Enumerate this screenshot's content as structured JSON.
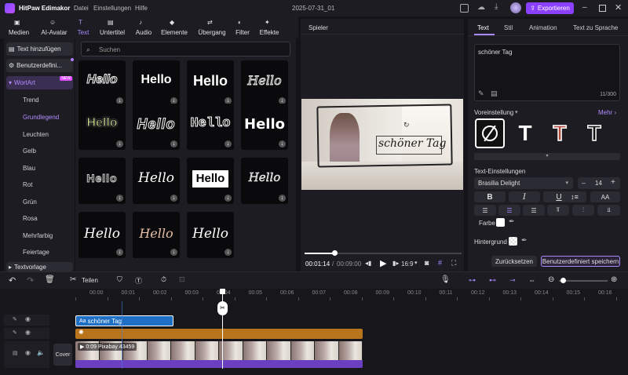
{
  "app": {
    "title": "HitPaw Edimakor",
    "project": "2025-07-31_01",
    "export": "Exportieren"
  },
  "menu": [
    "Datei",
    "Einstellungen",
    "Hilfe"
  ],
  "toolbar": [
    {
      "label": "Medien",
      "icon": "media-icon"
    },
    {
      "label": "AI-Avatar",
      "icon": "avatar-icon"
    },
    {
      "label": "Text",
      "icon": "text-icon"
    },
    {
      "label": "Untertitel",
      "icon": "subtitle-icon"
    },
    {
      "label": "Audio",
      "icon": "audio-icon"
    },
    {
      "label": "Elemente",
      "icon": "elements-icon"
    },
    {
      "label": "Übergang",
      "icon": "transition-icon"
    },
    {
      "label": "Filter",
      "icon": "filter-icon"
    },
    {
      "label": "Effekte",
      "icon": "effects-icon"
    }
  ],
  "sidebar": {
    "add_text": "Text hinzufügen",
    "custom": "Benutzerdefini...",
    "wordart": "WortArt",
    "wordart_badge": "NEW",
    "categories": [
      "Trend",
      "Grundlegend",
      "Leuchten",
      "Gelb",
      "Blau",
      "Rot",
      "Grün",
      "Rosa",
      "Mehrfarbig",
      "Feiertage"
    ],
    "textvorlage": "Textvorlage"
  },
  "search": {
    "placeholder": "Suchen"
  },
  "thumbs": {
    "hello": "Hello",
    "hello_lower": "Hello",
    "hello_script": "Hello"
  },
  "player": {
    "title": "Spieler",
    "overlay_text": "schöner Tag",
    "time_current": "00:01:14",
    "time_sep": "/",
    "time_total": "00:09:00",
    "ratio": "16:9",
    "progress": 0.19
  },
  "right": {
    "tabs": [
      "Text",
      "Stil",
      "Animation",
      "Text zu Sprache"
    ],
    "text_value": "schöner Tag",
    "char_count": "11/300",
    "preset_label": "Voreinstellung",
    "more": "Mehr",
    "text_settings": "Text-Einstellungen",
    "font": "Brasilia Delight",
    "font_size": "14",
    "bold": "B",
    "italic": "I",
    "underline": "U",
    "case": "AA",
    "color_label": "Farbe",
    "background_label": "Hintergrund",
    "reset": "Zurücksetzen",
    "save_custom": "Benutzerdefiniert speichern"
  },
  "timeline_tools": {
    "split": "Teilen"
  },
  "ruler": [
    "00:00",
    "00:01",
    "00:02",
    "00:03",
    "00:04",
    "00:05",
    "00:06",
    "00:07",
    "00:08",
    "00:09",
    "00:10",
    "00:11",
    "00:12",
    "00:13",
    "00:14",
    "00:15",
    "00:16",
    "00:17"
  ],
  "tracks": {
    "text_clip": "schöner Tag",
    "video_clip": "0:09 Pixabay 43459",
    "cover": "Cover"
  },
  "colors": {
    "accent": "#a06cff",
    "export": "#8b3fff",
    "text_clip": "#1f6fc5",
    "effect_clip": "#b8741a",
    "video_clip": "#6a3fc0"
  }
}
